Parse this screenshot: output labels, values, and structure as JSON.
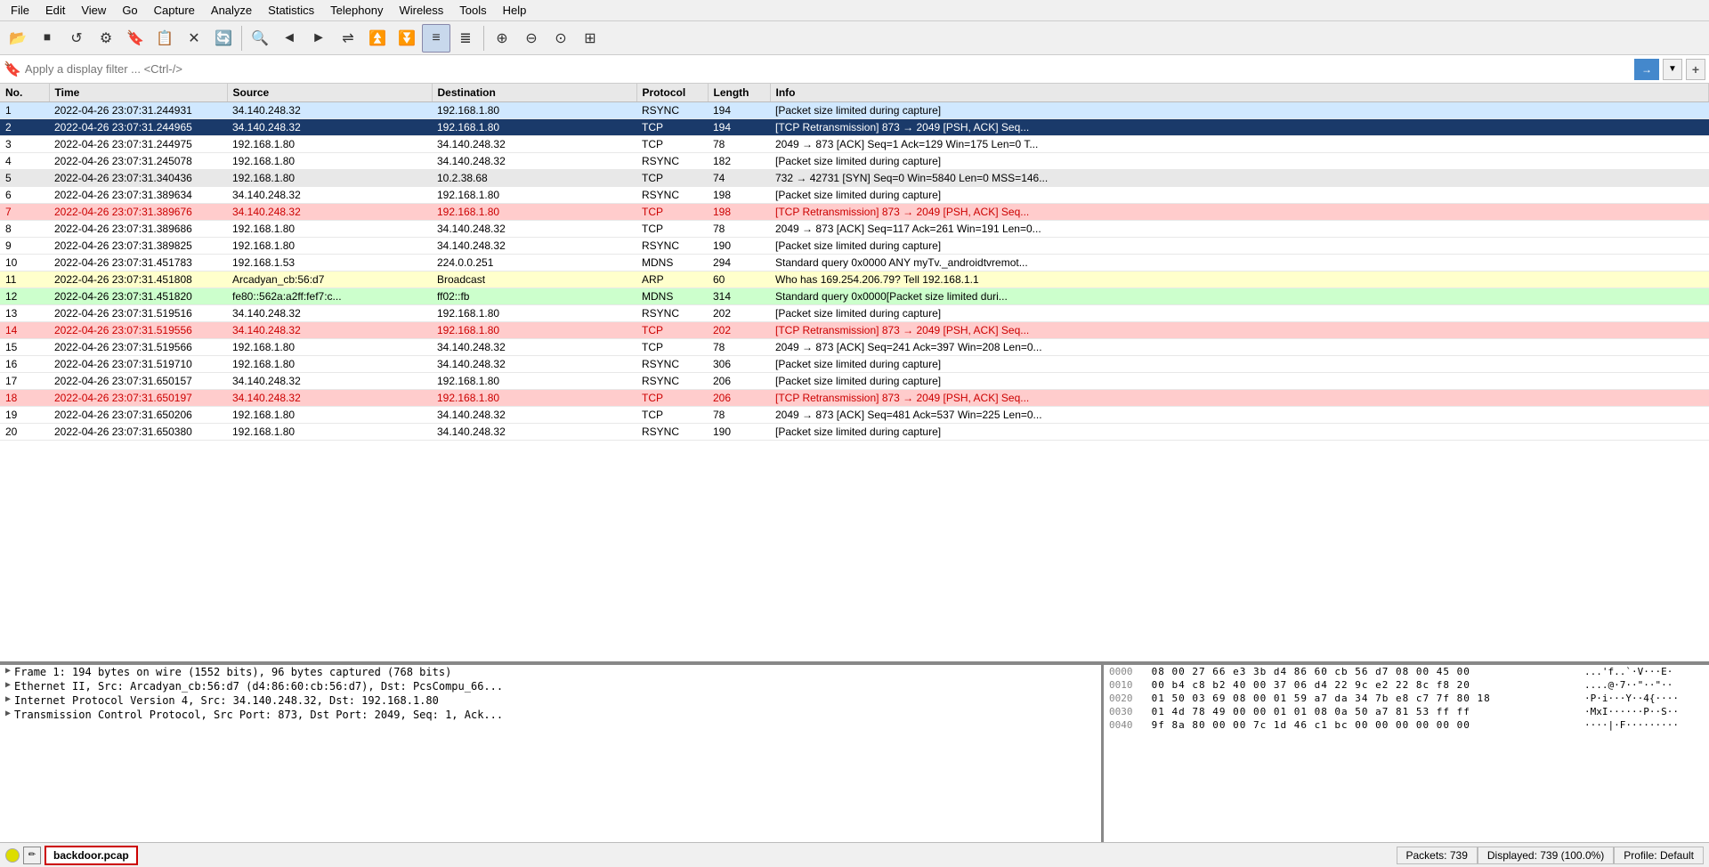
{
  "menu": {
    "items": [
      "File",
      "Edit",
      "View",
      "Go",
      "Capture",
      "Analyze",
      "Statistics",
      "Telephony",
      "Wireless",
      "Tools",
      "Help"
    ]
  },
  "toolbar": {
    "buttons": [
      {
        "name": "open-icon",
        "symbol": "📂"
      },
      {
        "name": "stop-icon",
        "symbol": "⏹"
      },
      {
        "name": "restart-icon",
        "symbol": "↺"
      },
      {
        "name": "options-icon",
        "symbol": "⚙"
      },
      {
        "name": "bookmark-icon",
        "symbol": "🔖"
      },
      {
        "name": "list-icon",
        "symbol": "📋"
      },
      {
        "name": "close-icon",
        "symbol": "✕"
      },
      {
        "name": "reload-icon",
        "symbol": "🔄"
      },
      {
        "sep": true
      },
      {
        "name": "search-icon",
        "symbol": "🔍"
      },
      {
        "name": "back-icon",
        "symbol": "◀"
      },
      {
        "name": "forward-icon",
        "symbol": "▶"
      },
      {
        "name": "goto-icon",
        "symbol": "⇌"
      },
      {
        "name": "first-icon",
        "symbol": "⏫"
      },
      {
        "name": "last-icon",
        "symbol": "⏬"
      },
      {
        "name": "colorize-icon",
        "symbol": "≡",
        "active": true
      },
      {
        "name": "autoscroll-icon",
        "symbol": "≣"
      },
      {
        "sep": true
      },
      {
        "name": "zoom-in-icon",
        "symbol": "🔎"
      },
      {
        "name": "zoom-out-icon",
        "symbol": "🔍"
      },
      {
        "name": "zoom-reset-icon",
        "symbol": "🔍"
      },
      {
        "name": "zoom-fit-icon",
        "symbol": "⊞"
      }
    ]
  },
  "filter": {
    "placeholder": "Apply a display filter ... <Ctrl-/>",
    "value": ""
  },
  "table": {
    "columns": [
      "No.",
      "Time",
      "Source",
      "Destination",
      "Protocol",
      "Length",
      "Info"
    ],
    "rows": [
      {
        "no": "1",
        "time": "2022-04-26 23:07:31.244931",
        "src": "34.140.248.32",
        "dst": "192.168.1.80",
        "proto": "RSYNC",
        "len": "194",
        "info": "[Packet size limited during capture]",
        "style": "rsync-blue"
      },
      {
        "no": "2",
        "time": "2022-04-26 23:07:31.244965",
        "src": "34.140.248.32",
        "dst": "192.168.1.80",
        "proto": "TCP",
        "len": "194",
        "info": "[TCP Retransmission] 873 → 2049 [PSH, ACK] Seq...",
        "style": "selected-dark"
      },
      {
        "no": "3",
        "time": "2022-04-26 23:07:31.244975",
        "src": "192.168.1.80",
        "dst": "34.140.248.32",
        "proto": "TCP",
        "len": "78",
        "info": "2049 → 873 [ACK] Seq=1 Ack=129 Win=175 Len=0 T...",
        "style": "normal"
      },
      {
        "no": "4",
        "time": "2022-04-26 23:07:31.245078",
        "src": "192.168.1.80",
        "dst": "34.140.248.32",
        "proto": "RSYNC",
        "len": "182",
        "info": "[Packet size limited during capture]",
        "style": "normal"
      },
      {
        "no": "5",
        "time": "2022-04-26 23:07:31.340436",
        "src": "192.168.1.80",
        "dst": "10.2.38.68",
        "proto": "TCP",
        "len": "74",
        "info": "732 → 42731 [SYN] Seq=0 Win=5840 Len=0 MSS=146...",
        "style": "gray"
      },
      {
        "no": "6",
        "time": "2022-04-26 23:07:31.389634",
        "src": "34.140.248.32",
        "dst": "192.168.1.80",
        "proto": "RSYNC",
        "len": "198",
        "info": "[Packet size limited during capture]",
        "style": "normal"
      },
      {
        "no": "7",
        "time": "2022-04-26 23:07:31.389676",
        "src": "34.140.248.32",
        "dst": "192.168.1.80",
        "proto": "TCP",
        "len": "198",
        "info": "[TCP Retransmission] 873 → 2049 [PSH, ACK] Seq...",
        "style": "tcp-ret"
      },
      {
        "no": "8",
        "time": "2022-04-26 23:07:31.389686",
        "src": "192.168.1.80",
        "dst": "34.140.248.32",
        "proto": "TCP",
        "len": "78",
        "info": "2049 → 873 [ACK] Seq=117 Ack=261 Win=191 Len=0...",
        "style": "normal"
      },
      {
        "no": "9",
        "time": "2022-04-26 23:07:31.389825",
        "src": "192.168.1.80",
        "dst": "34.140.248.32",
        "proto": "RSYNC",
        "len": "190",
        "info": "[Packet size limited during capture]",
        "style": "normal"
      },
      {
        "no": "10",
        "time": "2022-04-26 23:07:31.451783",
        "src": "192.168.1.53",
        "dst": "224.0.0.251",
        "proto": "MDNS",
        "len": "294",
        "info": "Standard query 0x0000 ANY myTv._androidtvremot...",
        "style": "normal"
      },
      {
        "no": "11",
        "time": "2022-04-26 23:07:31.451808",
        "src": "Arcadyan_cb:56:d7",
        "dst": "Broadcast",
        "proto": "ARP",
        "len": "60",
        "info": "Who has 169.254.206.79? Tell 192.168.1.1",
        "style": "arp"
      },
      {
        "no": "12",
        "time": "2022-04-26 23:07:31.451820",
        "src": "fe80::562a:a2ff:fef7:c...",
        "dst": "ff02::fb",
        "proto": "MDNS",
        "len": "314",
        "info": "Standard query 0x0000[Packet size limited duri...",
        "style": "mdns-alt"
      },
      {
        "no": "13",
        "time": "2022-04-26 23:07:31.519516",
        "src": "34.140.248.32",
        "dst": "192.168.1.80",
        "proto": "RSYNC",
        "len": "202",
        "info": "[Packet size limited during capture]",
        "style": "normal"
      },
      {
        "no": "14",
        "time": "2022-04-26 23:07:31.519556",
        "src": "34.140.248.32",
        "dst": "192.168.1.80",
        "proto": "TCP",
        "len": "202",
        "info": "[TCP Retransmission] 873 → 2049 [PSH, ACK] Seq...",
        "style": "tcp-ret"
      },
      {
        "no": "15",
        "time": "2022-04-26 23:07:31.519566",
        "src": "192.168.1.80",
        "dst": "34.140.248.32",
        "proto": "TCP",
        "len": "78",
        "info": "2049 → 873 [ACK] Seq=241 Ack=397 Win=208 Len=0...",
        "style": "normal"
      },
      {
        "no": "16",
        "time": "2022-04-26 23:07:31.519710",
        "src": "192.168.1.80",
        "dst": "34.140.248.32",
        "proto": "RSYNC",
        "len": "306",
        "info": "[Packet size limited during capture]",
        "style": "normal"
      },
      {
        "no": "17",
        "time": "2022-04-26 23:07:31.650157",
        "src": "34.140.248.32",
        "dst": "192.168.1.80",
        "proto": "RSYNC",
        "len": "206",
        "info": "[Packet size limited during capture]",
        "style": "normal"
      },
      {
        "no": "18",
        "time": "2022-04-26 23:07:31.650197",
        "src": "34.140.248.32",
        "dst": "192.168.1.80",
        "proto": "TCP",
        "len": "206",
        "info": "[TCP Retransmission] 873 → 2049 [PSH, ACK] Seq...",
        "style": "tcp-ret"
      },
      {
        "no": "19",
        "time": "2022-04-26 23:07:31.650206",
        "src": "192.168.1.80",
        "dst": "34.140.248.32",
        "proto": "TCP",
        "len": "78",
        "info": "2049 → 873 [ACK] Seq=481 Ack=537 Win=225 Len=0...",
        "style": "normal"
      },
      {
        "no": "20",
        "time": "2022-04-26 23:07:31.650380",
        "src": "192.168.1.80",
        "dst": "34.140.248.32",
        "proto": "RSYNC",
        "len": "190",
        "info": "[Packet size limited during capture]",
        "style": "normal"
      }
    ]
  },
  "detail": {
    "rows": [
      {
        "arrow": "▶",
        "text": "Frame 1: 194 bytes on wire (1552 bits), 96 bytes captured (768 bits)"
      },
      {
        "arrow": "▶",
        "text": "Ethernet II, Src: Arcadyan_cb:56:d7 (d4:86:60:cb:56:d7), Dst: PcsCompu_66..."
      },
      {
        "arrow": "▶",
        "text": "Internet Protocol Version 4, Src: 34.140.248.32, Dst: 192.168.1.80"
      },
      {
        "arrow": "▶",
        "text": "Transmission Control Protocol, Src Port: 873, Dst Port: 2049, Seq: 1, Ack..."
      }
    ]
  },
  "hex": {
    "rows": [
      {
        "offset": "0000",
        "bytes": "08 00 27 66 e3 3b d4 86  60 cb 56 d7 08 00 45 00",
        "ascii": "...'f..`·V···E·"
      },
      {
        "offset": "0010",
        "bytes": "00 b4 c8 b2 40 00 37 06  d4 22 9c e2 22 8c f8 20",
        "ascii": "....@·7··\"··\"·· "
      },
      {
        "offset": "0020",
        "bytes": "01 50 03 69 08 00 01 59  a7 da 34 7b e8 c7 7f 80 18",
        "ascii": "·P·i···Y··4{····"
      },
      {
        "offset": "0030",
        "bytes": "01 4d 78 49 00 00 01 01  08 0a 50 a7 81 53 ff ff",
        "ascii": "·MxI······P··S··"
      },
      {
        "offset": "0040",
        "bytes": "9f 8a 80 00 00 7c 1d 46  c1 bc 00 00 00 00 00 00",
        "ascii": "····|·F·········"
      }
    ]
  },
  "status": {
    "filename": "backdoor.pcap",
    "packets_label": "Packets: 739",
    "displayed_label": "Displayed: 739 (100.0%)",
    "profile_label": "Profile: Default"
  }
}
